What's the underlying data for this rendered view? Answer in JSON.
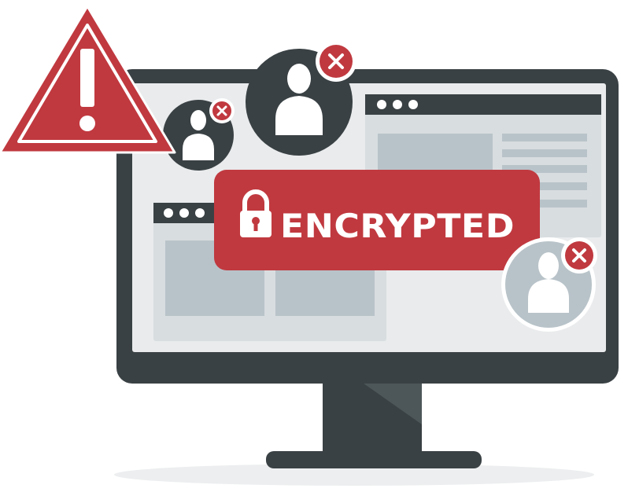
{
  "badge": {
    "label": "ENCRYPTED",
    "icon": "padlock-icon"
  },
  "colors": {
    "red": "#c0393f",
    "dark": "#3a4144",
    "gray": "#b8c3c9",
    "light": "#e9ebec",
    "white": "#ffffff"
  }
}
